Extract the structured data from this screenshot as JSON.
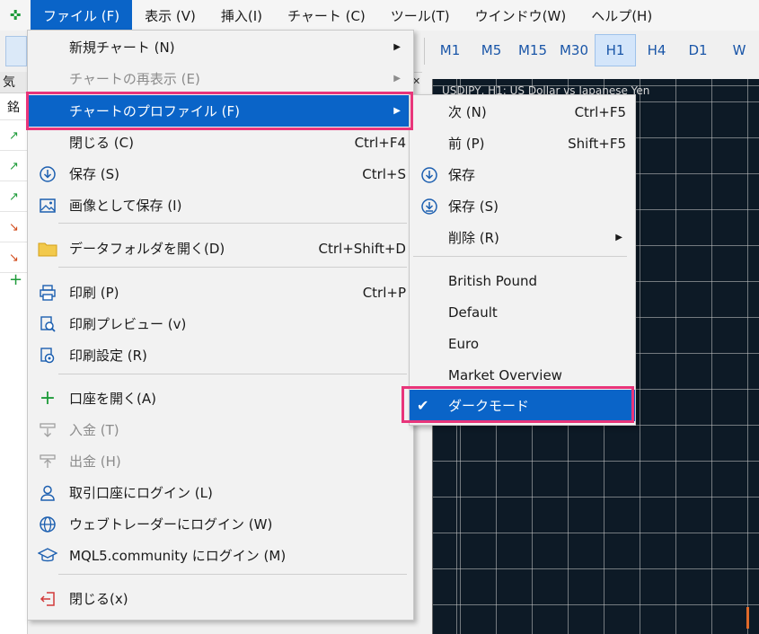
{
  "menubar": {
    "app_icon": "✜",
    "items": [
      {
        "label": "ファイル (F)",
        "active": true
      },
      {
        "label": "表示 (V)"
      },
      {
        "label": "挿入(I)"
      },
      {
        "label": "チャート (C)"
      },
      {
        "label": "ツール(T)"
      },
      {
        "label": "ウインドウ(W)"
      },
      {
        "label": "ヘルプ(H)"
      }
    ]
  },
  "toolbar": {
    "timeframes": [
      "M1",
      "M5",
      "M15",
      "M30",
      "H1",
      "H4",
      "D1",
      "W"
    ],
    "active_timeframe": "H1"
  },
  "market_watch": {
    "header": "気配",
    "column": "銘"
  },
  "chart": {
    "title": "USDJPY, H1: US Dollar vs Japanese Yen",
    "background": "#0d1a26"
  },
  "file_menu": {
    "items": [
      {
        "label": "新規チャート (N)",
        "icon": "none",
        "has_submenu": true
      },
      {
        "label": "チャートの再表示 (E)",
        "icon": "none",
        "has_submenu": true,
        "disabled": true
      },
      {
        "label": "チャートのプロファイル (F)",
        "icon": "none",
        "has_submenu": true,
        "highlighted": true
      },
      {
        "label": "閉じる (C)",
        "icon": "none",
        "shortcut": "Ctrl+F4"
      },
      {
        "label": "保存 (S)",
        "icon": "save-icon",
        "shortcut": "Ctrl+S"
      },
      {
        "label": "画像として保存 (I)",
        "icon": "image-icon"
      },
      {
        "label": "データフォルダを開く(D)",
        "icon": "folder-icon",
        "shortcut": "Ctrl+Shift+D"
      },
      {
        "label": "印刷 (P)",
        "icon": "print-icon",
        "shortcut": "Ctrl+P"
      },
      {
        "label": "印刷プレビュー (v)",
        "icon": "print-preview-icon"
      },
      {
        "label": "印刷設定 (R)",
        "icon": "print-settings-icon"
      },
      {
        "label": "口座を開く(A)",
        "icon": "plus-icon"
      },
      {
        "label": "入金 (T)",
        "icon": "deposit-icon",
        "disabled": true
      },
      {
        "label": "出金 (H)",
        "icon": "withdraw-icon",
        "disabled": true
      },
      {
        "label": "取引口座にログイン (L)",
        "icon": "user-icon"
      },
      {
        "label": "ウェブトレーダーにログイン (W)",
        "icon": "globe-icon"
      },
      {
        "label": "MQL5.community にログイン (M)",
        "icon": "graduation-cap-icon"
      },
      {
        "label": "閉じる(x)",
        "icon": "exit-icon"
      }
    ]
  },
  "profile_submenu": {
    "items": [
      {
        "label": "次 (N)",
        "shortcut": "Ctrl+F5"
      },
      {
        "label": "前 (P)",
        "shortcut": "Shift+F5"
      },
      {
        "label": "保存",
        "icon": "save-icon"
      },
      {
        "label": "保存 (S)",
        "icon": "save-as-icon"
      },
      {
        "label": "削除 (R)",
        "has_submenu": true
      },
      {
        "label": "British Pound"
      },
      {
        "label": "Default"
      },
      {
        "label": "Euro"
      },
      {
        "label": "Market Overview"
      },
      {
        "label": "ダークモード",
        "checked": true,
        "highlighted": true
      }
    ]
  },
  "colors": {
    "highlight": "#0a64c8",
    "annotation": "#e8357a",
    "up": "#1e9b3a",
    "down": "#d24a1a"
  }
}
